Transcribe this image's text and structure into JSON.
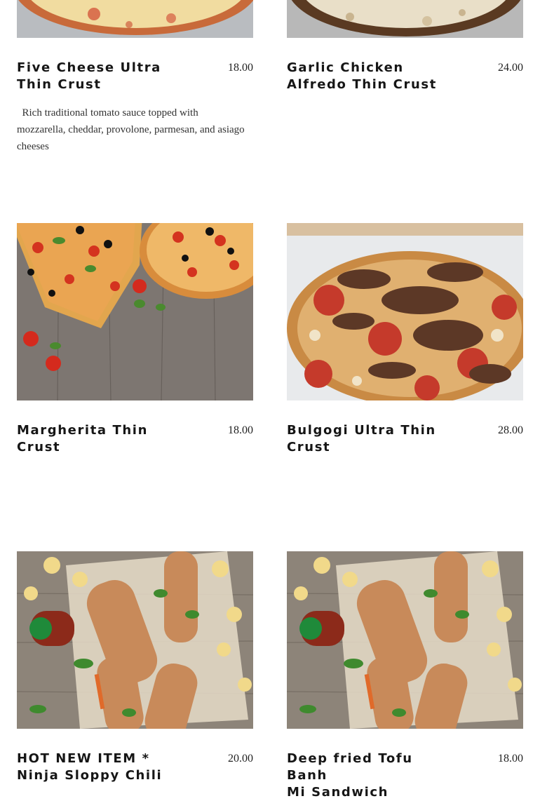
{
  "menu": {
    "items": [
      {
        "name": "Five Cheese Ultra\nThin Crust",
        "price": "18.00",
        "description": "  Rich traditional tomato sauce topped with mozzarella, cheddar, provolone, parmesan, and asiago cheeses"
      },
      {
        "name": "Garlic Chicken\nAlfredo Thin Crust",
        "price": "24.00"
      },
      {
        "name": "Margherita Thin\nCrust",
        "price": "18.00"
      },
      {
        "name": "Bulgogi Ultra Thin\nCrust",
        "price": "28.00"
      },
      {
        "name": "HOT NEW ITEM *\nNinja Sloppy Chili",
        "price": "20.00"
      },
      {
        "name": "Deep fried Tofu Banh\nMi Sandwich",
        "price": "18.00"
      }
    ]
  }
}
